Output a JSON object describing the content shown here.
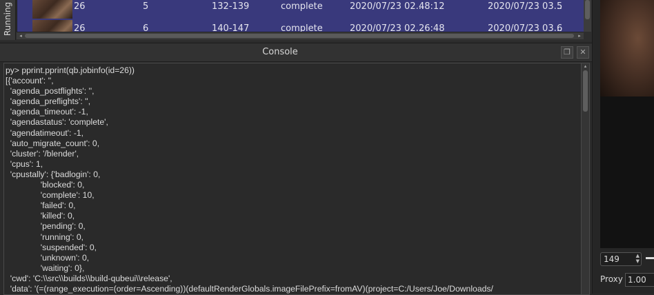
{
  "jobs_panel": {
    "side_tab_label": "Running J",
    "rows": [
      {
        "job_id": "26",
        "instance": "5",
        "frames": "132-139",
        "status": "complete",
        "start": "2020/07/23 02...",
        "elapsed": "48:12",
        "end": "2020/07/23 03...",
        "last": "5"
      },
      {
        "job_id": "26",
        "instance": "6",
        "frames": "140-147",
        "status": "complete",
        "start": "2020/07/23 02...",
        "elapsed": "26:48",
        "end": "2020/07/23 03...",
        "last": "6"
      }
    ]
  },
  "console": {
    "title": "Console",
    "restore_icon": "restore-window-icon",
    "close_icon": "close-icon",
    "text": "py> pprint.pprint(qb.jobinfo(id=26))\n[{'account': '',\n  'agenda_postflights': '',\n  'agenda_preflights': '',\n  'agenda_timeout': -1,\n  'agendastatus': 'complete',\n  'agendatimeout': -1,\n  'auto_migrate_count': 0,\n  'cluster': '/blender',\n  'cpus': 1,\n  'cpustally': {'badlogin': 0,\n               'blocked': 0,\n               'complete': 10,\n               'failed': 0,\n               'killed': 0,\n               'pending': 0,\n               'running': 0,\n               'suspended': 0,\n               'unknown': 0,\n               'waiting': 0},\n  'cwd': 'C:\\\\src\\\\builds\\\\build-qubeui\\\\release',\n  'data': '(=(range_execution=(order=Ascending))(defaultRenderGlobals.imageFilePrefix=fromAV)(project=C:/Users/Joe/Downloads/"
  },
  "preview_panel": {
    "frame_value": "149",
    "proxy_label": "Proxy",
    "proxy_value": "1.00"
  }
}
